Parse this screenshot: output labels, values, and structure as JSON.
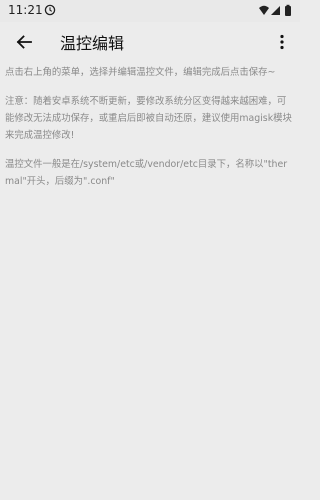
{
  "status_bar": {
    "time": "11:21"
  },
  "app_bar": {
    "title": "温控编辑"
  },
  "content": {
    "hint": "点击右上角的菜单，选择并编辑温控文件，编辑完成后点击保存~",
    "notice": "注意：随着安卓系统不断更新，要修改系统分区变得越来越困难，可能修改无法成功保存，或重启后即被自动还原，建议使用magisk模块来完成温控修改!",
    "info": "温控文件一般是在/system/etc或/vendor/etc目录下，名称以\"thermal\"开头，后缀为\".conf\""
  },
  "icons": {
    "status_clock": "clock-icon",
    "wifi": "wifi-icon",
    "signal": "signal-icon",
    "battery": "battery-icon",
    "back": "arrow-back-icon",
    "more": "more-vert-icon"
  },
  "colors": {
    "background": "#ececec",
    "body_text": "#8a8a8a",
    "title_text": "#111111"
  }
}
